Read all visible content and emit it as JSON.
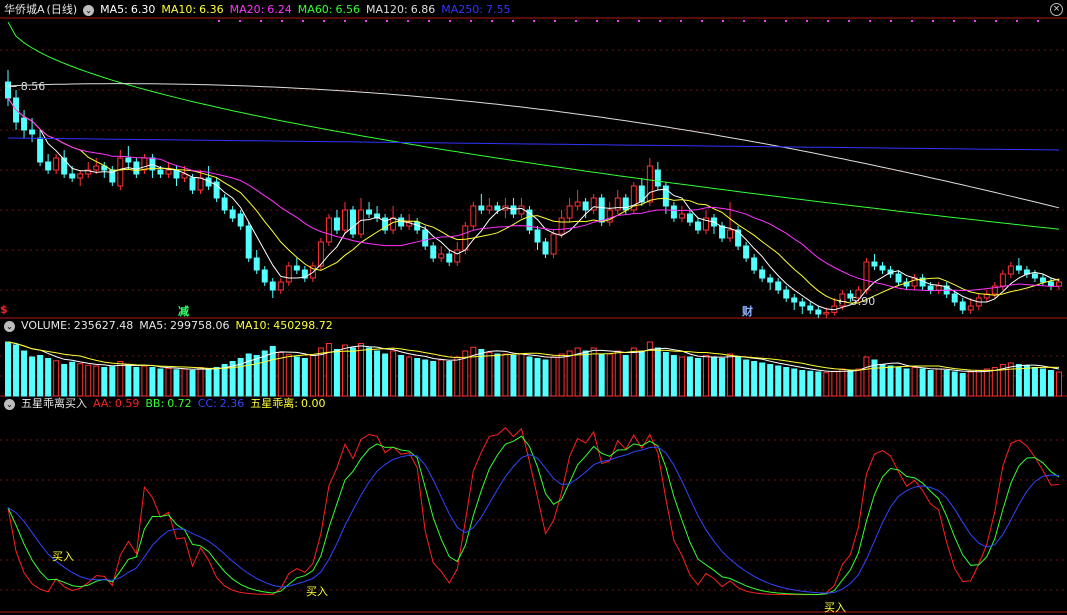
{
  "main": {
    "stock_name": "华侨城A",
    "period": "(日线)",
    "ma": [
      {
        "label": "MA5:",
        "value": "6.30",
        "color": "#ffffff"
      },
      {
        "label": "MA10:",
        "value": "6.36",
        "color": "#ffff33"
      },
      {
        "label": "MA20:",
        "value": "6.24",
        "color": "#ff33ff"
      },
      {
        "label": "MA60:",
        "value": "6.56",
        "color": "#33ff33"
      },
      {
        "label": "MA120:",
        "value": "6.86",
        "color": "#dddddd"
      },
      {
        "label": "MA250:",
        "value": "7.55",
        "color": "#3333ff"
      }
    ],
    "high_label": "8.56",
    "low_label": "5.90",
    "markers": [
      {
        "text": "$",
        "color": "#ff2020"
      },
      {
        "text": "减",
        "color": "#33ff66"
      },
      {
        "text": "财",
        "color": "#8fb4ff"
      }
    ]
  },
  "volume": {
    "label": "VOLUME:",
    "value": "235627.48",
    "ma5_label": "MA5:",
    "ma5_value": "299758.06",
    "ma10_label": "MA10:",
    "ma10_value": "450298.72"
  },
  "indicator": {
    "name": "五星乖离买入",
    "items": [
      {
        "label": "AA:",
        "value": "0.59",
        "color": "#ff2020"
      },
      {
        "label": "BB:",
        "value": "0.72",
        "color": "#33ff33"
      },
      {
        "label": "CC:",
        "value": "2.36",
        "color": "#3344ff"
      },
      {
        "label": "五星乖离:",
        "value": "0.00",
        "color": "#ffff33"
      }
    ],
    "buy_label": "买入"
  },
  "chart_data": {
    "type": "candlestick",
    "up_color": "#ff3232",
    "down_color": "#54ffff",
    "price_range": [
      5.6,
      9.2
    ],
    "candles": [
      [
        8.4,
        8.2,
        8.55,
        8.1
      ],
      [
        8.2,
        7.9,
        8.3,
        7.8
      ],
      [
        7.95,
        7.8,
        8.05,
        7.7
      ],
      [
        7.8,
        7.75,
        7.95,
        7.65
      ],
      [
        7.7,
        7.4,
        7.8,
        7.35
      ],
      [
        7.4,
        7.3,
        7.5,
        7.25
      ],
      [
        7.3,
        7.45,
        7.5,
        7.25
      ],
      [
        7.45,
        7.25,
        7.55,
        7.2
      ],
      [
        7.25,
        7.2,
        7.35,
        7.15
      ],
      [
        7.2,
        7.25,
        7.3,
        7.1
      ],
      [
        7.25,
        7.3,
        7.4,
        7.2
      ],
      [
        7.3,
        7.35,
        7.45,
        7.25
      ],
      [
        7.35,
        7.3,
        7.4,
        7.2
      ],
      [
        7.3,
        7.15,
        7.35,
        7.1
      ],
      [
        7.1,
        7.45,
        7.55,
        7.05
      ],
      [
        7.45,
        7.4,
        7.6,
        7.3
      ],
      [
        7.4,
        7.25,
        7.45,
        7.2
      ],
      [
        7.3,
        7.45,
        7.5,
        7.25
      ],
      [
        7.45,
        7.3,
        7.5,
        7.2
      ],
      [
        7.3,
        7.25,
        7.35,
        7.2
      ],
      [
        7.25,
        7.3,
        7.4,
        7.2
      ],
      [
        7.3,
        7.2,
        7.35,
        7.1
      ],
      [
        7.2,
        7.25,
        7.35,
        7.15
      ],
      [
        7.2,
        7.05,
        7.25,
        7.0
      ],
      [
        7.05,
        7.2,
        7.3,
        7.0
      ],
      [
        7.2,
        7.1,
        7.35,
        7.05
      ],
      [
        7.15,
        6.95,
        7.2,
        6.9
      ],
      [
        6.95,
        6.8,
        7.0,
        6.75
      ],
      [
        6.8,
        6.7,
        6.85,
        6.65
      ],
      [
        6.75,
        6.6,
        6.8,
        6.55
      ],
      [
        6.6,
        6.2,
        6.65,
        6.15
      ],
      [
        6.2,
        6.05,
        6.3,
        6.0
      ],
      [
        6.05,
        5.9,
        6.1,
        5.85
      ],
      [
        5.9,
        5.8,
        5.95,
        5.7
      ],
      [
        5.8,
        5.9,
        5.95,
        5.75
      ],
      [
        5.9,
        6.1,
        6.15,
        5.85
      ],
      [
        6.1,
        6.05,
        6.2,
        6.0
      ],
      [
        6.05,
        5.95,
        6.1,
        5.9
      ],
      [
        5.95,
        6.1,
        6.15,
        5.9
      ],
      [
        6.1,
        6.4,
        6.45,
        6.05
      ],
      [
        6.4,
        6.7,
        6.75,
        6.35
      ],
      [
        6.7,
        6.55,
        6.8,
        6.5
      ],
      [
        6.55,
        6.8,
        6.9,
        6.5
      ],
      [
        6.8,
        6.5,
        6.85,
        6.45
      ],
      [
        6.5,
        6.8,
        6.95,
        6.45
      ],
      [
        6.8,
        6.75,
        6.9,
        6.7
      ],
      [
        6.75,
        6.7,
        6.85,
        6.65
      ],
      [
        6.7,
        6.55,
        6.75,
        6.5
      ],
      [
        6.55,
        6.7,
        6.85,
        6.5
      ],
      [
        6.7,
        6.6,
        6.75,
        6.55
      ],
      [
        6.6,
        6.65,
        6.75,
        6.55
      ],
      [
        6.65,
        6.55,
        6.7,
        6.5
      ],
      [
        6.55,
        6.35,
        6.6,
        6.3
      ],
      [
        6.35,
        6.2,
        6.4,
        6.15
      ],
      [
        6.2,
        6.25,
        6.35,
        6.15
      ],
      [
        6.25,
        6.15,
        6.3,
        6.1
      ],
      [
        6.15,
        6.3,
        6.4,
        6.1
      ],
      [
        6.3,
        6.6,
        6.65,
        6.25
      ],
      [
        6.6,
        6.85,
        6.9,
        6.55
      ],
      [
        6.85,
        6.8,
        7.0,
        6.75
      ],
      [
        6.8,
        6.85,
        6.95,
        6.75
      ],
      [
        6.85,
        6.8,
        6.9,
        6.75
      ],
      [
        6.8,
        6.85,
        6.95,
        6.7
      ],
      [
        6.85,
        6.75,
        6.95,
        6.7
      ],
      [
        6.75,
        6.85,
        6.95,
        6.7
      ],
      [
        6.8,
        6.55,
        6.85,
        6.5
      ],
      [
        6.55,
        6.4,
        6.6,
        6.3
      ],
      [
        6.4,
        6.25,
        6.45,
        6.2
      ],
      [
        6.25,
        6.5,
        6.55,
        6.2
      ],
      [
        6.5,
        6.7,
        6.8,
        6.45
      ],
      [
        6.7,
        6.85,
        6.95,
        6.65
      ],
      [
        6.85,
        6.9,
        7.05,
        6.8
      ],
      [
        6.9,
        6.8,
        6.95,
        6.7
      ],
      [
        6.8,
        6.95,
        7.0,
        6.75
      ],
      [
        6.95,
        6.65,
        7.0,
        6.6
      ],
      [
        6.65,
        6.8,
        6.9,
        6.6
      ],
      [
        6.8,
        6.95,
        7.05,
        6.75
      ],
      [
        6.95,
        6.8,
        7.0,
        6.75
      ],
      [
        6.8,
        7.1,
        7.15,
        6.75
      ],
      [
        7.1,
        6.9,
        7.2,
        6.85
      ],
      [
        6.9,
        7.35,
        7.45,
        6.85
      ],
      [
        7.3,
        7.1,
        7.4,
        7.05
      ],
      [
        7.1,
        6.85,
        7.15,
        6.75
      ],
      [
        6.85,
        6.7,
        6.9,
        6.65
      ],
      [
        6.7,
        6.75,
        6.85,
        6.65
      ],
      [
        6.75,
        6.65,
        6.8,
        6.6
      ],
      [
        6.65,
        6.55,
        6.7,
        6.5
      ],
      [
        6.55,
        6.7,
        6.8,
        6.5
      ],
      [
        6.7,
        6.6,
        6.75,
        6.5
      ],
      [
        6.6,
        6.45,
        6.65,
        6.4
      ],
      [
        6.45,
        6.55,
        6.9,
        6.4
      ],
      [
        6.55,
        6.35,
        6.6,
        6.3
      ],
      [
        6.35,
        6.2,
        6.4,
        6.15
      ],
      [
        6.2,
        6.05,
        6.25,
        6.0
      ],
      [
        6.05,
        5.95,
        6.1,
        5.9
      ],
      [
        5.95,
        5.9,
        6.0,
        5.8
      ],
      [
        5.9,
        5.8,
        5.95,
        5.75
      ],
      [
        5.8,
        5.7,
        5.85,
        5.65
      ],
      [
        5.7,
        5.65,
        5.75,
        5.55
      ],
      [
        5.65,
        5.6,
        5.7,
        5.5
      ],
      [
        5.6,
        5.55,
        5.65,
        5.5
      ],
      [
        5.55,
        5.5,
        5.6,
        5.45
      ],
      [
        5.5,
        5.52,
        5.58,
        5.45
      ],
      [
        5.52,
        5.6,
        5.7,
        5.48
      ],
      [
        5.6,
        5.75,
        5.8,
        5.55
      ],
      [
        5.75,
        5.7,
        5.8,
        5.65
      ],
      [
        5.7,
        5.8,
        5.85,
        5.65
      ],
      [
        5.8,
        6.15,
        6.2,
        5.75
      ],
      [
        6.15,
        6.1,
        6.25,
        6.05
      ],
      [
        6.1,
        6.05,
        6.15,
        6.0
      ],
      [
        6.05,
        6.0,
        6.1,
        5.95
      ],
      [
        6.0,
        5.9,
        6.05,
        5.85
      ],
      [
        5.9,
        5.85,
        5.95,
        5.8
      ],
      [
        5.85,
        5.95,
        6.0,
        5.8
      ],
      [
        5.95,
        5.85,
        6.0,
        5.8
      ],
      [
        5.85,
        5.8,
        5.9,
        5.75
      ],
      [
        5.8,
        5.85,
        5.9,
        5.75
      ],
      [
        5.85,
        5.75,
        5.9,
        5.7
      ],
      [
        5.75,
        5.65,
        5.8,
        5.6
      ],
      [
        5.65,
        5.55,
        5.7,
        5.5
      ],
      [
        5.55,
        5.6,
        5.7,
        5.5
      ],
      [
        5.6,
        5.7,
        5.75,
        5.55
      ],
      [
        5.7,
        5.75,
        5.8,
        5.65
      ],
      [
        5.75,
        5.85,
        5.9,
        5.7
      ],
      [
        5.85,
        6.0,
        6.05,
        5.8
      ],
      [
        6.0,
        6.1,
        6.15,
        5.95
      ],
      [
        6.1,
        6.05,
        6.2,
        6.0
      ],
      [
        6.05,
        6.0,
        6.1,
        5.95
      ],
      [
        6.0,
        5.95,
        6.05,
        5.9
      ],
      [
        5.95,
        5.9,
        6.0,
        5.85
      ],
      [
        5.9,
        5.85,
        5.95,
        5.8
      ],
      [
        5.85,
        5.9,
        5.95,
        5.8
      ]
    ],
    "volume_range": [
      0,
      800000
    ],
    "volumes": [
      720,
      680,
      600,
      520,
      540,
      500,
      470,
      420,
      450,
      430,
      410,
      400,
      380,
      390,
      460,
      420,
      380,
      400,
      380,
      360,
      370,
      350,
      360,
      340,
      380,
      360,
      380,
      420,
      460,
      500,
      560,
      540,
      600,
      660,
      580,
      550,
      520,
      500,
      540,
      640,
      700,
      620,
      680,
      640,
      700,
      640,
      600,
      560,
      600,
      540,
      520,
      500,
      480,
      460,
      480,
      460,
      520,
      600,
      650,
      620,
      580,
      560,
      560,
      540,
      560,
      520,
      500,
      480,
      520,
      560,
      600,
      640,
      600,
      640,
      560,
      560,
      600,
      540,
      640,
      600,
      720,
      640,
      580,
      540,
      520,
      520,
      500,
      540,
      520,
      500,
      560,
      520,
      480,
      460,
      440,
      420,
      400,
      380,
      360,
      340,
      330,
      320,
      310,
      330,
      360,
      340,
      360,
      520,
      480,
      420,
      400,
      380,
      360,
      380,
      360,
      340,
      360,
      340,
      320,
      300,
      320,
      340,
      360,
      380,
      420,
      440,
      420,
      400,
      380,
      360,
      340,
      320
    ],
    "volume_scale": 1000,
    "indicator_range": [
      -1.0,
      10.5
    ]
  }
}
